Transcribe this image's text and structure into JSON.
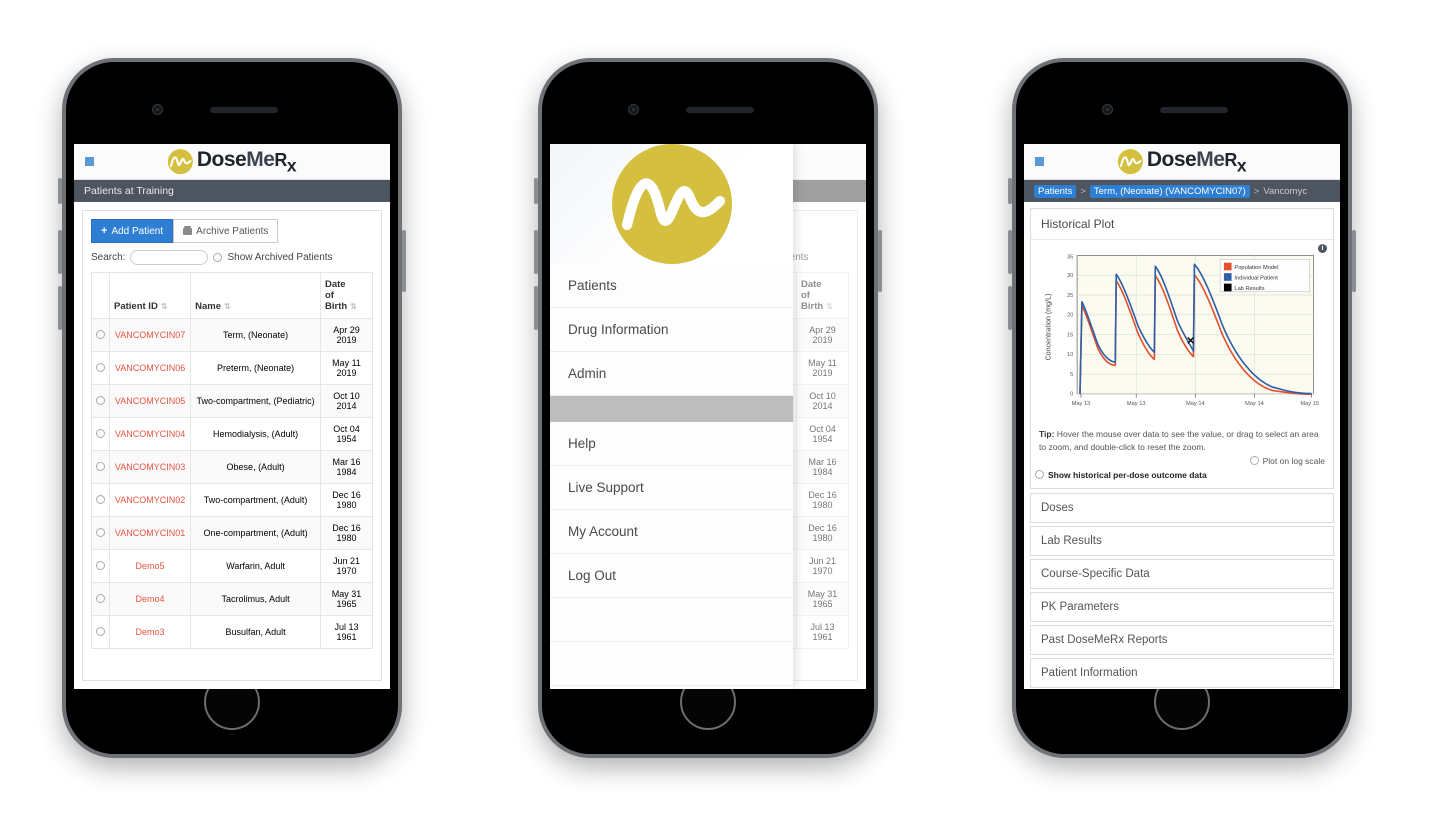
{
  "brand": {
    "name_dose": "Dose",
    "name_me": "Me",
    "name_rx": "R",
    "name_rx_sub": "x"
  },
  "phone1": {
    "header_title": "Patients at Training",
    "buttons": {
      "add_patient": "Add Patient",
      "archive_patients": "Archive Patients"
    },
    "search_label": "Search:",
    "show_archived_label": "Show Archived Patients",
    "table": {
      "columns": [
        "Patient ID",
        "Name",
        "Date of Birth"
      ],
      "col_dob_line1": "Date",
      "col_dob_line2": "of",
      "col_dob_line3": "Birth",
      "rows": [
        {
          "id": "VANCOMYCIN07",
          "name": "Term, (Neonate)",
          "dob1": "Apr 29",
          "dob2": "2019"
        },
        {
          "id": "VANCOMYCIN06",
          "name": "Preterm, (Neonate)",
          "dob1": "May 11",
          "dob2": "2019"
        },
        {
          "id": "VANCOMYCIN05",
          "name": "Two-compartment, (Pediatric)",
          "dob1": "Oct 10",
          "dob2": "2014"
        },
        {
          "id": "VANCOMYCIN04",
          "name": "Hemodialysis, (Adult)",
          "dob1": "Oct 04",
          "dob2": "1954"
        },
        {
          "id": "VANCOMYCIN03",
          "name": "Obese, (Adult)",
          "dob1": "Mar 16",
          "dob2": "1984"
        },
        {
          "id": "VANCOMYCIN02",
          "name": "Two-compartment, (Adult)",
          "dob1": "Dec 16",
          "dob2": "1980"
        },
        {
          "id": "VANCOMYCIN01",
          "name": "One-compartment, (Adult)",
          "dob1": "Dec 16",
          "dob2": "1980"
        },
        {
          "id": "Demo5",
          "name": "Warfarin, Adult",
          "dob1": "Jun 21",
          "dob2": "1970"
        },
        {
          "id": "Demo4",
          "name": "Tacrolimus, Adult",
          "dob1": "May 31",
          "dob2": "1965"
        },
        {
          "id": "Demo3",
          "name": "Busulfan, Adult",
          "dob1": "Jul 13",
          "dob2": "1961"
        }
      ]
    }
  },
  "phone2": {
    "menu_items_top": [
      "Patients",
      "Drug Information",
      "Admin"
    ],
    "menu_items_bottom": [
      "Help",
      "Live Support",
      "My Account",
      "Log Out"
    ]
  },
  "phone3": {
    "breadcrumb": {
      "root": "Patients",
      "sep": ">",
      "patient": "Term, (Neonate) (VANCOMYCIN07)",
      "tail": "Vancomyc"
    },
    "panel_title": "Historical Plot",
    "tip_bold": "Tip:",
    "tip_text": " Hover the mouse over data to see the value, or drag to select an area to zoom, and double-click to reset the zoom.",
    "log_scale_label": "Plot on log scale",
    "outcome_label": "Show historical per-dose outcome data",
    "sections": [
      "Doses",
      "Lab Results",
      "Course-Specific Data",
      "PK Parameters",
      "Past DoseMeRx Reports",
      "Patient Information"
    ]
  },
  "chart_data": {
    "type": "line",
    "title": "Historical Plot",
    "xlabel": "",
    "ylabel": "Concentration (mg/L)",
    "ylim": [
      0,
      35
    ],
    "yticks": [
      0,
      5,
      10,
      15,
      20,
      25,
      30,
      35
    ],
    "xticks": [
      "May 13",
      "May 13",
      "May 14",
      "May 14",
      "May 15"
    ],
    "grid": true,
    "legend_position": "top-right",
    "colors": {
      "population_model": "#e4502b",
      "individual_patient": "#2f5fa8",
      "lab_results": "#000000"
    },
    "series": [
      {
        "name": "Population Model",
        "color": "#e4502b",
        "peaks": [
          22.3,
          28.6,
          30.0,
          30.2
        ],
        "troughs": [
          7.2,
          8.7,
          9.4,
          0.9
        ],
        "x": [
          0,
          0.02,
          0.22,
          0.24,
          0.44,
          0.46,
          0.66,
          0.68,
          1.0
        ],
        "y": [
          0,
          22.3,
          7.2,
          28.6,
          8.7,
          30.0,
          9.4,
          30.2,
          0.9
        ]
      },
      {
        "name": "Individual Patient",
        "color": "#2f5fa8",
        "peaks": [
          23.3,
          30.3,
          32.3,
          32.8
        ],
        "troughs": [
          8.0,
          9.8,
          10.8,
          1.2
        ],
        "x": [
          0,
          0.02,
          0.22,
          0.24,
          0.44,
          0.46,
          0.66,
          0.68,
          1.0
        ],
        "y": [
          0,
          23.3,
          8.0,
          30.3,
          9.8,
          32.3,
          10.8,
          32.8,
          1.2
        ]
      },
      {
        "name": "Lab Results",
        "color": "#000000",
        "points": [
          {
            "x": 0.645,
            "y": 14.4
          }
        ]
      }
    ]
  }
}
